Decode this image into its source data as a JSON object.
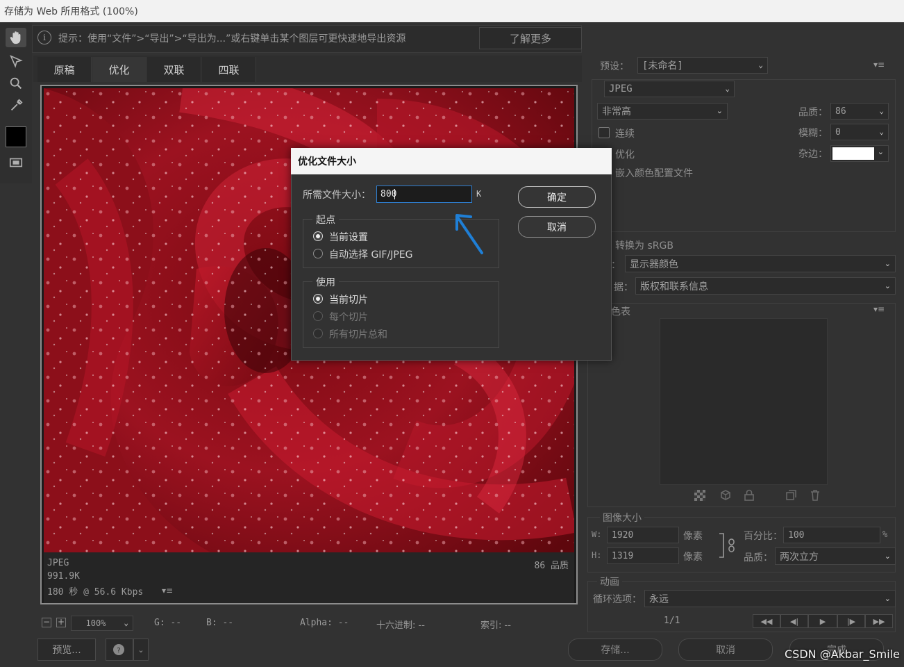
{
  "window": {
    "title": "存储为 Web 所用格式 (100%)"
  },
  "hint": {
    "text": "提示：使用“文件”>“导出”>“导出为...”或右键单击某个图层可更快速地导出资源",
    "learn_more": "了解更多"
  },
  "tabs": [
    "原稿",
    "优化",
    "双联",
    "四联"
  ],
  "active_tab": "优化",
  "image_info": {
    "format": "JPEG",
    "size": "991.9K",
    "time": "180 秒 @ 56.6 Kbps",
    "quality": "86 品质"
  },
  "bottom_bar": {
    "zoom": "100%",
    "g": "G: --",
    "b": "B: --",
    "alpha": "Alpha: --",
    "hex": "十六进制: --",
    "index": "索引: --",
    "preview_btn": "预览...",
    "save_btn": "存储...",
    "cancel_btn": "取消",
    "done_btn": "完成"
  },
  "settings": {
    "preset_label": "预设：",
    "preset_value": "[未命名]",
    "format": "JPEG",
    "quality_preset": "非常高",
    "quality_label": "品质：",
    "quality_value": "86",
    "blur_label": "模糊：",
    "blur_value": "0",
    "matte_label": "杂边：",
    "progressive": "连续",
    "optimized": "优化",
    "embed_profile": "嵌入颜色配置文件",
    "convert_srgb": "转换为 sRGB",
    "preview_label": "：",
    "preview_value": "显示器颜色",
    "metadata_label": "据：",
    "metadata_value": "版权和联系信息",
    "color_table": "色表"
  },
  "image_size": {
    "title": "图像大小",
    "w_label": "W:",
    "w_value": "1920",
    "w_unit": "像素",
    "h_label": "H:",
    "h_value": "1319",
    "h_unit": "像素",
    "percent_label": "百分比：",
    "percent_value": "100",
    "percent_unit": "%",
    "quality_label": "品质：",
    "quality_value": "两次立方"
  },
  "animation": {
    "title": "动画",
    "loop_label": "循环选项：",
    "loop_value": "永远",
    "frame": "1/1"
  },
  "dialog": {
    "title": "优化文件大小",
    "size_label": "所需文件大小：",
    "size_value": "800",
    "size_unit": "K",
    "ok": "确定",
    "cancel": "取消",
    "start_group": "起点",
    "start_current": "当前设置",
    "start_auto": "自动选择 GIF/JPEG",
    "use_group": "使用",
    "use_current_slice": "当前切片",
    "use_each_slice": "每个切片",
    "use_total": "所有切片总和"
  },
  "watermark": "CSDN @Akbar_Smile",
  "colors": {
    "accent_blue": "#1f7fd6",
    "panel": "#323232"
  }
}
